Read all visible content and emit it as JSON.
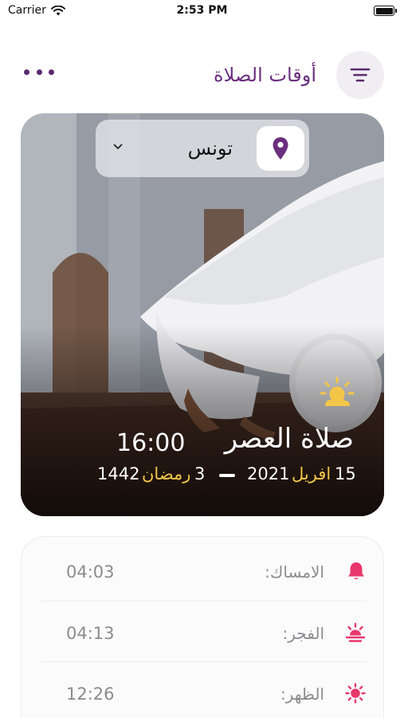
{
  "status_bar": {
    "carrier": "Carrier",
    "time": "2:53 PM"
  },
  "header": {
    "title": "أوقات الصلاة",
    "menu_icon": "more-dots-icon",
    "filter_icon": "filter-lines-icon"
  },
  "location": {
    "city": "تونس",
    "pin_icon": "map-pin-icon",
    "dropdown_icon": "chevron-down-icon"
  },
  "current_prayer": {
    "name": "صلاة العصر",
    "time": "16:00",
    "icon": "sun-cloud-icon",
    "gregorian_day": "15",
    "gregorian_month": "افريل",
    "gregorian_year": "2021",
    "hijri_day": "3",
    "hijri_month": "رمضان",
    "hijri_year": "1442"
  },
  "times": [
    {
      "label": "الامساك:",
      "time": "04:03",
      "icon": "bell-icon"
    },
    {
      "label": "الفجر:",
      "time": "04:13",
      "icon": "sunrise-icon"
    },
    {
      "label": "الظهر:",
      "time": "12:26",
      "icon": "sun-icon"
    }
  ],
  "colors": {
    "brand": "#6a2f7e",
    "gold": "#f3c64a",
    "accent": "#e8386b"
  }
}
